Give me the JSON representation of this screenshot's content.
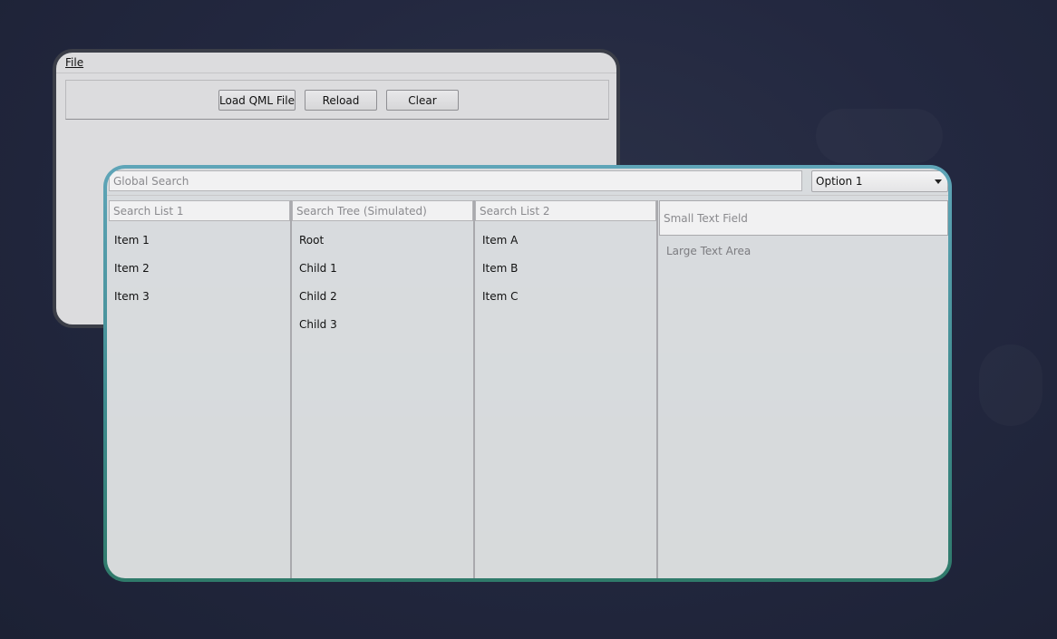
{
  "back_window": {
    "menu_file": "File",
    "buttons": {
      "load": "Load QML File",
      "reload": "Reload",
      "clear": "Clear"
    }
  },
  "front_window": {
    "global_search": {
      "placeholder": "Global Search",
      "value": ""
    },
    "combo": {
      "selected": "Option 1"
    },
    "list1": {
      "placeholder": "Search List 1",
      "items": [
        "Item 1",
        "Item 2",
        "Item 3"
      ]
    },
    "tree": {
      "placeholder": "Search Tree (Simulated)",
      "items": [
        "Root",
        "Child 1",
        "Child 2",
        "Child 3"
      ]
    },
    "list2": {
      "placeholder": "Search List 2",
      "items": [
        "Item A",
        "Item B",
        "Item C"
      ]
    },
    "small_text": {
      "placeholder": "Small Text Field"
    },
    "large_text": {
      "placeholder": "Large Text Area"
    }
  }
}
